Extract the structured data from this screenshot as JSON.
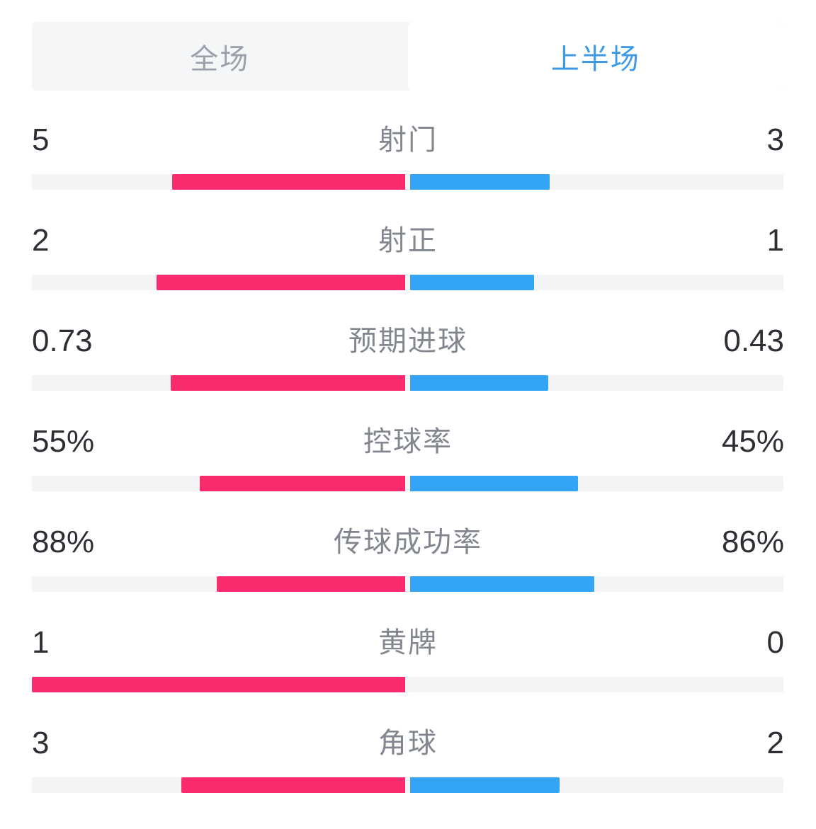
{
  "tabs": [
    {
      "label": "全场",
      "active": false
    },
    {
      "label": "上半场",
      "active": true
    }
  ],
  "colors": {
    "home_bar": "#FA2B6D",
    "away_bar": "#34A4F4",
    "bar_track": "#F4F4F6",
    "tabbar_background": "#F5F6F8",
    "tab_active_text": "#3F9AE6",
    "tab_inactive_text": "#9BA1AC",
    "stat_label_text": "#82868F",
    "stat_value_text": "#2E2E35"
  },
  "stats": [
    {
      "label": "射门",
      "home_value": "5",
      "away_value": "3",
      "home_pct": 62.5,
      "away_pct": 37.5
    },
    {
      "label": "射正",
      "home_value": "2",
      "away_value": "1",
      "home_pct": 66.7,
      "away_pct": 33.3
    },
    {
      "label": "预期进球",
      "home_value": "0.73",
      "away_value": "0.43",
      "home_pct": 62.9,
      "away_pct": 37.1
    },
    {
      "label": "控球率",
      "home_value": "55%",
      "away_value": "45%",
      "home_pct": 55.0,
      "away_pct": 45.0
    },
    {
      "label": "传球成功率",
      "home_value": "88%",
      "away_value": "86%",
      "home_pct": 50.6,
      "away_pct": 49.4
    },
    {
      "label": "黄牌",
      "home_value": "1",
      "away_value": "0",
      "home_pct": 100.0,
      "away_pct": 0.0
    },
    {
      "label": "角球",
      "home_value": "3",
      "away_value": "2",
      "home_pct": 60.0,
      "away_pct": 40.0
    }
  ],
  "chart_data": {
    "type": "bar",
    "title": "上半场",
    "categories": [
      "射门",
      "射正",
      "预期进球",
      "控球率",
      "传球成功率",
      "黄牌",
      "角球"
    ],
    "series": [
      {
        "name": "home",
        "values": [
          5,
          2,
          0.73,
          55,
          88,
          1,
          3
        ]
      },
      {
        "name": "away",
        "values": [
          3,
          1,
          0.43,
          45,
          86,
          0,
          2
        ]
      }
    ],
    "xlabel": "",
    "ylabel": "",
    "legend": "none",
    "grid": false
  }
}
